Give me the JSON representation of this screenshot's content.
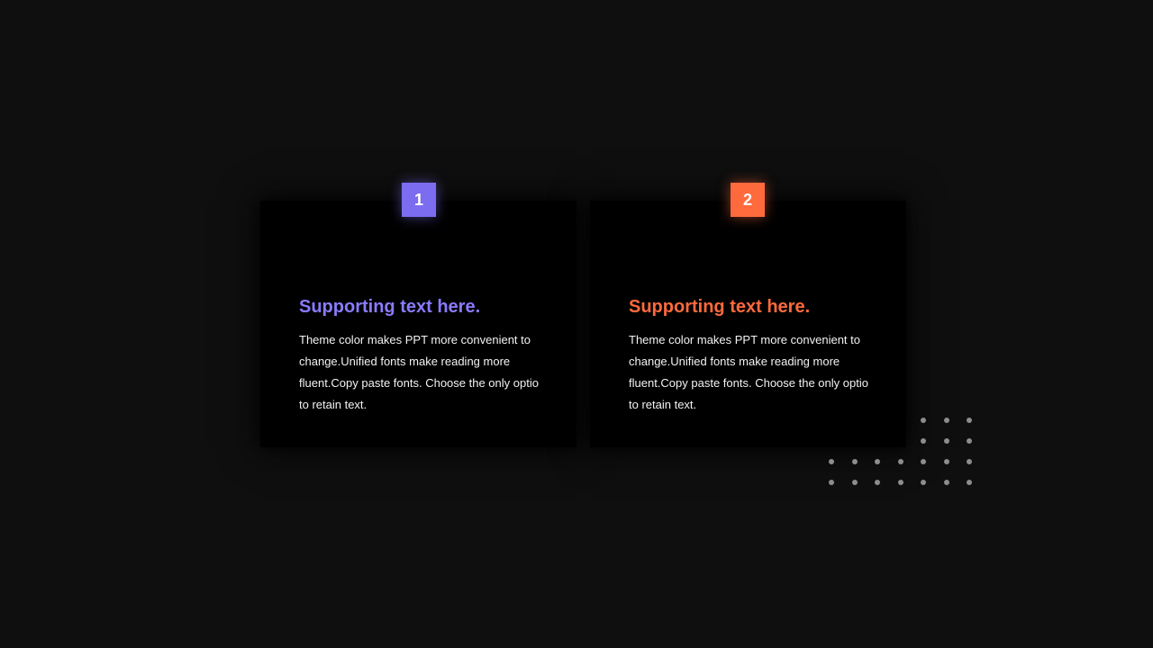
{
  "slide": {
    "background_color": "#0f0f0f",
    "cards": [
      {
        "number": "1",
        "accent_color": "#7b6cf0",
        "title": "Supporting text here.",
        "body": "Theme color makes PPT more convenient to change.Unified fonts make reading more fluent.Copy paste fonts. Choose the only optio to retain text."
      },
      {
        "number": "2",
        "accent_color": "#ff6a3d",
        "title": "Supporting text here.",
        "body": "Theme color makes PPT more convenient to change.Unified fonts make reading more fluent.Copy paste fonts. Choose the only optio to retain text."
      }
    ],
    "decoration": {
      "name": "dot-grid",
      "dot_color": "#8d8d8d"
    }
  }
}
